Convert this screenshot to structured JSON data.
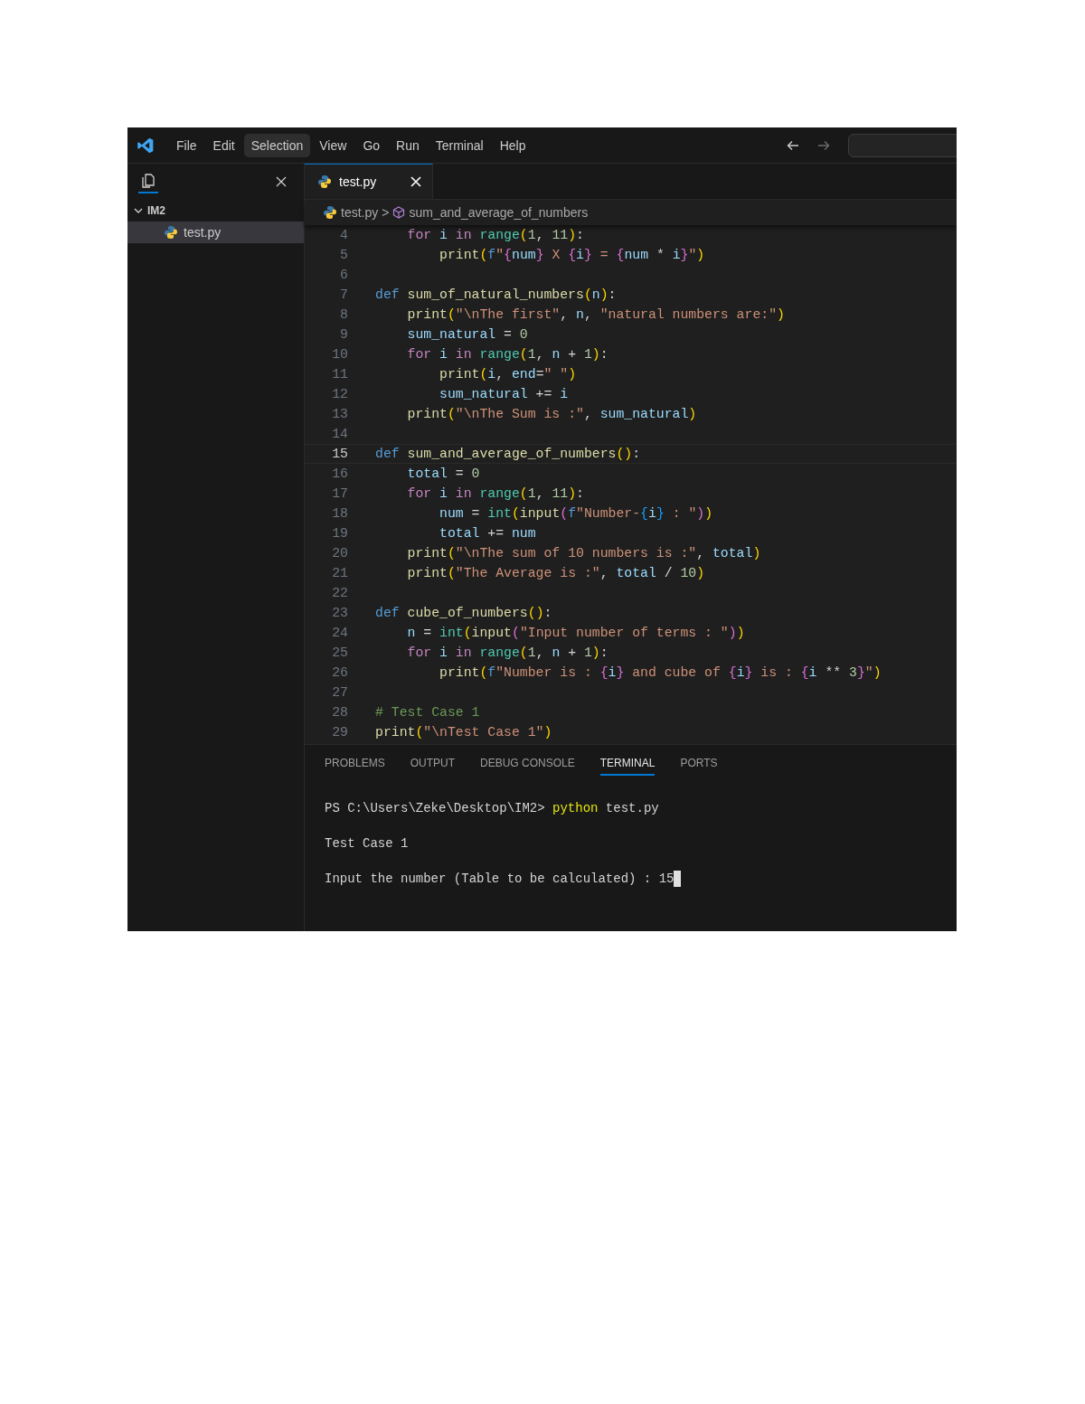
{
  "menu": {
    "items": [
      {
        "label": "File",
        "selected": false
      },
      {
        "label": "Edit",
        "selected": false
      },
      {
        "label": "Selection",
        "selected": true
      },
      {
        "label": "View",
        "selected": false
      },
      {
        "label": "Go",
        "selected": false
      },
      {
        "label": "Run",
        "selected": false
      },
      {
        "label": "Terminal",
        "selected": false
      },
      {
        "label": "Help",
        "selected": false
      }
    ]
  },
  "sidebar": {
    "folder": {
      "label": "IM2",
      "expanded": true,
      "children": [
        {
          "label": "test.py",
          "selected": true
        }
      ]
    }
  },
  "tabs": [
    {
      "label": "test.py",
      "selected": true
    }
  ],
  "breadcrumb": {
    "file": "test.py",
    "separator": ">",
    "symbol": "sum_and_average_of_numbers"
  },
  "code": [
    {
      "number": "4",
      "current": false,
      "tokens": [
        {
          "kind": "control",
          "text": "    for "
        },
        {
          "kind": "var",
          "text": "i "
        },
        {
          "kind": "control",
          "text": "in "
        },
        {
          "kind": "builtin",
          "text": "range"
        },
        {
          "kind": "bracket1",
          "text": "("
        },
        {
          "kind": "number",
          "text": "1"
        },
        {
          "kind": "plain",
          "text": ", "
        },
        {
          "kind": "number",
          "text": "11"
        },
        {
          "kind": "bracket1",
          "text": ")"
        },
        {
          "kind": "plain",
          "text": ":"
        }
      ]
    },
    {
      "number": "5",
      "current": false,
      "tokens": [
        {
          "kind": "func",
          "text": "        print"
        },
        {
          "kind": "bracket1",
          "text": "("
        },
        {
          "kind": "keyword",
          "text": "f"
        },
        {
          "kind": "string",
          "text": "\""
        },
        {
          "kind": "bracket2",
          "text": "{"
        },
        {
          "kind": "var",
          "text": "num"
        },
        {
          "kind": "bracket2",
          "text": "}"
        },
        {
          "kind": "string",
          "text": " X "
        },
        {
          "kind": "bracket2",
          "text": "{"
        },
        {
          "kind": "var",
          "text": "i"
        },
        {
          "kind": "bracket2",
          "text": "}"
        },
        {
          "kind": "string",
          "text": " = "
        },
        {
          "kind": "bracket2",
          "text": "{"
        },
        {
          "kind": "var",
          "text": "num"
        },
        {
          "kind": "plain",
          "text": " * "
        },
        {
          "kind": "var",
          "text": "i"
        },
        {
          "kind": "bracket2",
          "text": "}"
        },
        {
          "kind": "string",
          "text": "\""
        },
        {
          "kind": "bracket1",
          "text": ")"
        }
      ]
    },
    {
      "number": "6",
      "current": false
    },
    {
      "number": "7",
      "current": false,
      "tokens": [
        {
          "kind": "keyword",
          "text": "def "
        },
        {
          "kind": "func",
          "text": "sum_of_natural_numbers"
        },
        {
          "kind": "bracket1",
          "text": "("
        },
        {
          "kind": "var",
          "text": "n"
        },
        {
          "kind": "bracket1",
          "text": ")"
        },
        {
          "kind": "plain",
          "text": ":"
        }
      ]
    },
    {
      "number": "8",
      "current": false,
      "tokens": [
        {
          "kind": "func",
          "text": "    print"
        },
        {
          "kind": "bracket1",
          "text": "("
        },
        {
          "kind": "string",
          "text": "\"\\nThe first\""
        },
        {
          "kind": "plain",
          "text": ", "
        },
        {
          "kind": "var",
          "text": "n"
        },
        {
          "kind": "plain",
          "text": ", "
        },
        {
          "kind": "string",
          "text": "\"natural numbers are:\""
        },
        {
          "kind": "bracket1",
          "text": ")"
        }
      ]
    },
    {
      "number": "9",
      "current": false,
      "tokens": [
        {
          "kind": "var",
          "text": "    sum_natural"
        },
        {
          "kind": "plain",
          "text": " = "
        },
        {
          "kind": "number",
          "text": "0"
        }
      ]
    },
    {
      "number": "10",
      "current": false,
      "tokens": [
        {
          "kind": "control",
          "text": "    for "
        },
        {
          "kind": "var",
          "text": "i "
        },
        {
          "kind": "control",
          "text": "in "
        },
        {
          "kind": "builtin",
          "text": "range"
        },
        {
          "kind": "bracket1",
          "text": "("
        },
        {
          "kind": "number",
          "text": "1"
        },
        {
          "kind": "plain",
          "text": ", "
        },
        {
          "kind": "var",
          "text": "n"
        },
        {
          "kind": "plain",
          "text": " + "
        },
        {
          "kind": "number",
          "text": "1"
        },
        {
          "kind": "bracket1",
          "text": ")"
        },
        {
          "kind": "plain",
          "text": ":"
        }
      ]
    },
    {
      "number": "11",
      "current": false,
      "tokens": [
        {
          "kind": "func",
          "text": "        print"
        },
        {
          "kind": "bracket1",
          "text": "("
        },
        {
          "kind": "var",
          "text": "i"
        },
        {
          "kind": "plain",
          "text": ", "
        },
        {
          "kind": "var",
          "text": "end"
        },
        {
          "kind": "plain",
          "text": "="
        },
        {
          "kind": "string",
          "text": "\" \""
        },
        {
          "kind": "bracket1",
          "text": ")"
        }
      ]
    },
    {
      "number": "12",
      "current": false,
      "tokens": [
        {
          "kind": "var",
          "text": "        sum_natural"
        },
        {
          "kind": "plain",
          "text": " += "
        },
        {
          "kind": "var",
          "text": "i"
        }
      ]
    },
    {
      "number": "13",
      "current": false,
      "tokens": [
        {
          "kind": "func",
          "text": "    print"
        },
        {
          "kind": "bracket1",
          "text": "("
        },
        {
          "kind": "string",
          "text": "\"\\nThe Sum is :\""
        },
        {
          "kind": "plain",
          "text": ", "
        },
        {
          "kind": "var",
          "text": "sum_natural"
        },
        {
          "kind": "bracket1",
          "text": ")"
        }
      ]
    },
    {
      "number": "14",
      "current": false
    },
    {
      "number": "15",
      "current": true,
      "tokens": [
        {
          "kind": "keyword",
          "text": "def "
        },
        {
          "kind": "func",
          "text": "sum_and_average_of_numbers"
        },
        {
          "kind": "bracket1",
          "text": "("
        },
        {
          "kind": "bracket1",
          "text": ")"
        },
        {
          "kind": "plain",
          "text": ":"
        }
      ]
    },
    {
      "number": "16",
      "current": false,
      "tokens": [
        {
          "kind": "var",
          "text": "    total"
        },
        {
          "kind": "plain",
          "text": " = "
        },
        {
          "kind": "number",
          "text": "0"
        }
      ]
    },
    {
      "number": "17",
      "current": false,
      "tokens": [
        {
          "kind": "control",
          "text": "    for "
        },
        {
          "kind": "var",
          "text": "i "
        },
        {
          "kind": "control",
          "text": "in "
        },
        {
          "kind": "builtin",
          "text": "range"
        },
        {
          "kind": "bracket1",
          "text": "("
        },
        {
          "kind": "number",
          "text": "1"
        },
        {
          "kind": "plain",
          "text": ", "
        },
        {
          "kind": "number",
          "text": "11"
        },
        {
          "kind": "bracket1",
          "text": ")"
        },
        {
          "kind": "plain",
          "text": ":"
        }
      ]
    },
    {
      "number": "18",
      "current": false,
      "tokens": [
        {
          "kind": "var",
          "text": "        num"
        },
        {
          "kind": "plain",
          "text": " = "
        },
        {
          "kind": "builtin",
          "text": "int"
        },
        {
          "kind": "bracket1",
          "text": "("
        },
        {
          "kind": "func",
          "text": "input"
        },
        {
          "kind": "bracket2",
          "text": "("
        },
        {
          "kind": "keyword",
          "text": "f"
        },
        {
          "kind": "string",
          "text": "\"Number-"
        },
        {
          "kind": "bracket3",
          "text": "{"
        },
        {
          "kind": "var",
          "text": "i"
        },
        {
          "kind": "bracket3",
          "text": "}"
        },
        {
          "kind": "string",
          "text": " : \""
        },
        {
          "kind": "bracket2",
          "text": ")"
        },
        {
          "kind": "bracket1",
          "text": ")"
        }
      ]
    },
    {
      "number": "19",
      "current": false,
      "tokens": [
        {
          "kind": "var",
          "text": "        total"
        },
        {
          "kind": "plain",
          "text": " += "
        },
        {
          "kind": "var",
          "text": "num"
        }
      ]
    },
    {
      "number": "20",
      "current": false,
      "tokens": [
        {
          "kind": "func",
          "text": "    print"
        },
        {
          "kind": "bracket1",
          "text": "("
        },
        {
          "kind": "string",
          "text": "\"\\nThe sum of 10 numbers is :\""
        },
        {
          "kind": "plain",
          "text": ", "
        },
        {
          "kind": "var",
          "text": "total"
        },
        {
          "kind": "bracket1",
          "text": ")"
        }
      ]
    },
    {
      "number": "21",
      "current": false,
      "tokens": [
        {
          "kind": "func",
          "text": "    print"
        },
        {
          "kind": "bracket1",
          "text": "("
        },
        {
          "kind": "string",
          "text": "\"The Average is :\""
        },
        {
          "kind": "plain",
          "text": ", "
        },
        {
          "kind": "var",
          "text": "total"
        },
        {
          "kind": "plain",
          "text": " / "
        },
        {
          "kind": "number",
          "text": "10"
        },
        {
          "kind": "bracket1",
          "text": ")"
        }
      ]
    },
    {
      "number": "22",
      "current": false
    },
    {
      "number": "23",
      "current": false,
      "tokens": [
        {
          "kind": "keyword",
          "text": "def "
        },
        {
          "kind": "func",
          "text": "cube_of_numbers"
        },
        {
          "kind": "bracket1",
          "text": "("
        },
        {
          "kind": "bracket1",
          "text": ")"
        },
        {
          "kind": "plain",
          "text": ":"
        }
      ]
    },
    {
      "number": "24",
      "current": false,
      "tokens": [
        {
          "kind": "var",
          "text": "    n"
        },
        {
          "kind": "plain",
          "text": " = "
        },
        {
          "kind": "builtin",
          "text": "int"
        },
        {
          "kind": "bracket1",
          "text": "("
        },
        {
          "kind": "func",
          "text": "input"
        },
        {
          "kind": "bracket2",
          "text": "("
        },
        {
          "kind": "string",
          "text": "\"Input number of terms : \""
        },
        {
          "kind": "bracket2",
          "text": ")"
        },
        {
          "kind": "bracket1",
          "text": ")"
        }
      ]
    },
    {
      "number": "25",
      "current": false,
      "tokens": [
        {
          "kind": "control",
          "text": "    for "
        },
        {
          "kind": "var",
          "text": "i "
        },
        {
          "kind": "control",
          "text": "in "
        },
        {
          "kind": "builtin",
          "text": "range"
        },
        {
          "kind": "bracket1",
          "text": "("
        },
        {
          "kind": "number",
          "text": "1"
        },
        {
          "kind": "plain",
          "text": ", "
        },
        {
          "kind": "var",
          "text": "n"
        },
        {
          "kind": "plain",
          "text": " + "
        },
        {
          "kind": "number",
          "text": "1"
        },
        {
          "kind": "bracket1",
          "text": ")"
        },
        {
          "kind": "plain",
          "text": ":"
        }
      ]
    },
    {
      "number": "26",
      "current": false,
      "tokens": [
        {
          "kind": "func",
          "text": "        print"
        },
        {
          "kind": "bracket1",
          "text": "("
        },
        {
          "kind": "keyword",
          "text": "f"
        },
        {
          "kind": "string",
          "text": "\"Number is : "
        },
        {
          "kind": "bracket2",
          "text": "{"
        },
        {
          "kind": "var",
          "text": "i"
        },
        {
          "kind": "bracket2",
          "text": "}"
        },
        {
          "kind": "string",
          "text": " and cube of "
        },
        {
          "kind": "bracket2",
          "text": "{"
        },
        {
          "kind": "var",
          "text": "i"
        },
        {
          "kind": "bracket2",
          "text": "}"
        },
        {
          "kind": "string",
          "text": " is : "
        },
        {
          "kind": "bracket2",
          "text": "{"
        },
        {
          "kind": "var",
          "text": "i"
        },
        {
          "kind": "plain",
          "text": " ** "
        },
        {
          "kind": "number",
          "text": "3"
        },
        {
          "kind": "bracket2",
          "text": "}"
        },
        {
          "kind": "string",
          "text": "\""
        },
        {
          "kind": "bracket1",
          "text": ")"
        }
      ]
    },
    {
      "number": "27",
      "current": false
    },
    {
      "number": "28",
      "current": false,
      "tokens": [
        {
          "kind": "comment",
          "text": "# Test Case 1"
        }
      ]
    },
    {
      "number": "29",
      "current": false,
      "tokens": [
        {
          "kind": "func",
          "text": "print"
        },
        {
          "kind": "bracket1",
          "text": "("
        },
        {
          "kind": "string",
          "text": "\"\\nTest Case 1\""
        },
        {
          "kind": "bracket1",
          "text": ")"
        }
      ]
    }
  ],
  "panel": {
    "tabs": [
      {
        "label": "PROBLEMS",
        "selected": false
      },
      {
        "label": "OUTPUT",
        "selected": false
      },
      {
        "label": "DEBUG CONSOLE",
        "selected": false
      },
      {
        "label": "TERMINAL",
        "selected": true
      },
      {
        "label": "PORTS",
        "selected": false
      }
    ],
    "terminal": [
      {
        "tokens": [
          {
            "kind": "plain",
            "text": "PS C:\\Users\\Zeke\\Desktop\\IM2> "
          },
          {
            "kind": "command",
            "text": "python"
          },
          {
            "kind": "plain",
            "text": " test.py"
          }
        ],
        "cursor": false
      },
      {
        "tokens": [
          {
            "kind": "plain",
            "text": "Test Case 1"
          }
        ],
        "cursor": false
      },
      {
        "tokens": [
          {
            "kind": "plain",
            "text": "Input the number (Table to be calculated) : 15"
          }
        ],
        "cursor": true
      }
    ]
  }
}
